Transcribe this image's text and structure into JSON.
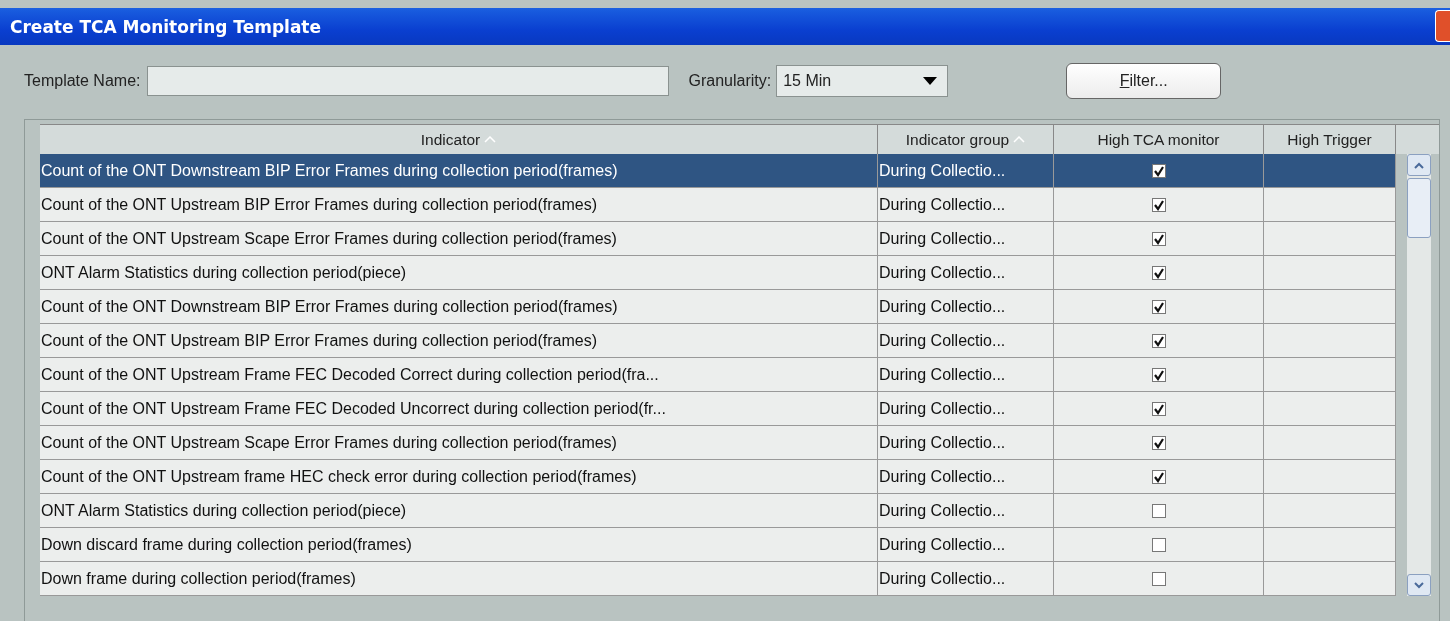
{
  "window": {
    "title": "Create TCA Monitoring Template"
  },
  "form": {
    "template_name": {
      "label": "Template Name:"
    },
    "granularity": {
      "label": "Granularity:",
      "value": "15 Min"
    },
    "filter_button": "Filter..."
  },
  "table": {
    "columns": [
      {
        "label": "Indicator",
        "sorted": true
      },
      {
        "label": "Indicator group",
        "sorted": true
      },
      {
        "label": "High TCA monitor",
        "sorted": false
      },
      {
        "label": "High Trigger",
        "sorted": false
      }
    ],
    "rows": [
      {
        "indicator": "Count of the ONT Downstream BIP Error Frames during collection period(frames)",
        "group": "During Collectio...",
        "checked": true,
        "selected": true
      },
      {
        "indicator": "Count of the ONT Upstream BIP Error Frames during collection period(frames)",
        "group": "During Collectio...",
        "checked": true,
        "selected": false
      },
      {
        "indicator": "Count of the ONT Upstream Scape Error Frames during collection period(frames)",
        "group": "During Collectio...",
        "checked": true,
        "selected": false
      },
      {
        "indicator": "ONT Alarm Statistics during collection period(piece)",
        "group": "During Collectio...",
        "checked": true,
        "selected": false
      },
      {
        "indicator": "Count of the ONT Downstream BIP Error Frames during collection period(frames)",
        "group": "During Collectio...",
        "checked": true,
        "selected": false
      },
      {
        "indicator": "Count of the ONT Upstream BIP Error Frames during collection period(frames)",
        "group": "During Collectio...",
        "checked": true,
        "selected": false
      },
      {
        "indicator": "Count of the ONT Upstream Frame FEC Decoded Correct during collection period(fra...",
        "group": "During Collectio...",
        "checked": true,
        "selected": false
      },
      {
        "indicator": "Count of the ONT Upstream Frame FEC Decoded Uncorrect during collection period(fr...",
        "group": "During Collectio...",
        "checked": true,
        "selected": false
      },
      {
        "indicator": "Count of the ONT Upstream Scape Error Frames during collection period(frames)",
        "group": "During Collectio...",
        "checked": true,
        "selected": false
      },
      {
        "indicator": "Count of the ONT Upstream frame HEC check error during collection period(frames)",
        "group": "During Collectio...",
        "checked": true,
        "selected": false
      },
      {
        "indicator": "ONT Alarm Statistics during collection period(piece)",
        "group": "During Collectio...",
        "checked": false,
        "selected": false
      },
      {
        "indicator": "Down discard frame during collection period(frames)",
        "group": "During Collectio...",
        "checked": false,
        "selected": false
      },
      {
        "indicator": "Down frame during collection period(frames)",
        "group": "During Collectio...",
        "checked": false,
        "selected": false
      }
    ]
  }
}
